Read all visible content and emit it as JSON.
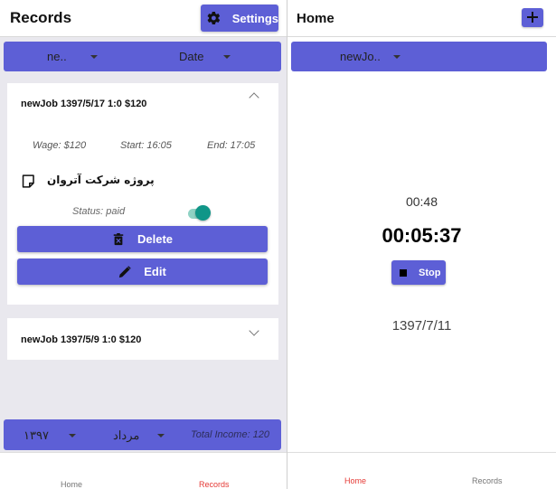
{
  "records_screen": {
    "title": "Records",
    "settings_label": "Settings",
    "filter": {
      "job": "ne..",
      "sort": "Date"
    },
    "cards": [
      {
        "title": "newJob 1397/5/17 1:0 $120",
        "expanded": true,
        "wage": "Wage: $120",
        "start": "Start: 16:05",
        "end": "End: 17:05",
        "description": "پروژه شرکت آتروان",
        "status": "Status: paid",
        "paid": true,
        "delete_label": "Delete",
        "edit_label": "Edit"
      },
      {
        "title": "newJob 1397/5/9 1:0 $120",
        "expanded": false
      }
    ],
    "footer": {
      "year": "۱۳۹۷",
      "month": "مرداد",
      "total_income": "Total Income: 120"
    },
    "nav": {
      "home": "Home",
      "records": "Records"
    }
  },
  "home_screen": {
    "title": "Home",
    "filter": {
      "job": "newJo.."
    },
    "elapsed": "00:48",
    "clock": "00:05:37",
    "stop_label": "Stop",
    "date": "1397/7/11",
    "nav": {
      "home": "Home",
      "records": "Records"
    }
  },
  "colors": {
    "accent": "#5d5fd6",
    "toggle": "#109688",
    "active_nav": "#e53935",
    "inactive_nav": "#757575"
  },
  "icons": [
    "gear-icon",
    "note-icon",
    "trash-icon",
    "pencil-icon",
    "plus-icon",
    "stop-icon",
    "chevron-up-icon",
    "chevron-down-icon",
    "caret-down-icon"
  ]
}
